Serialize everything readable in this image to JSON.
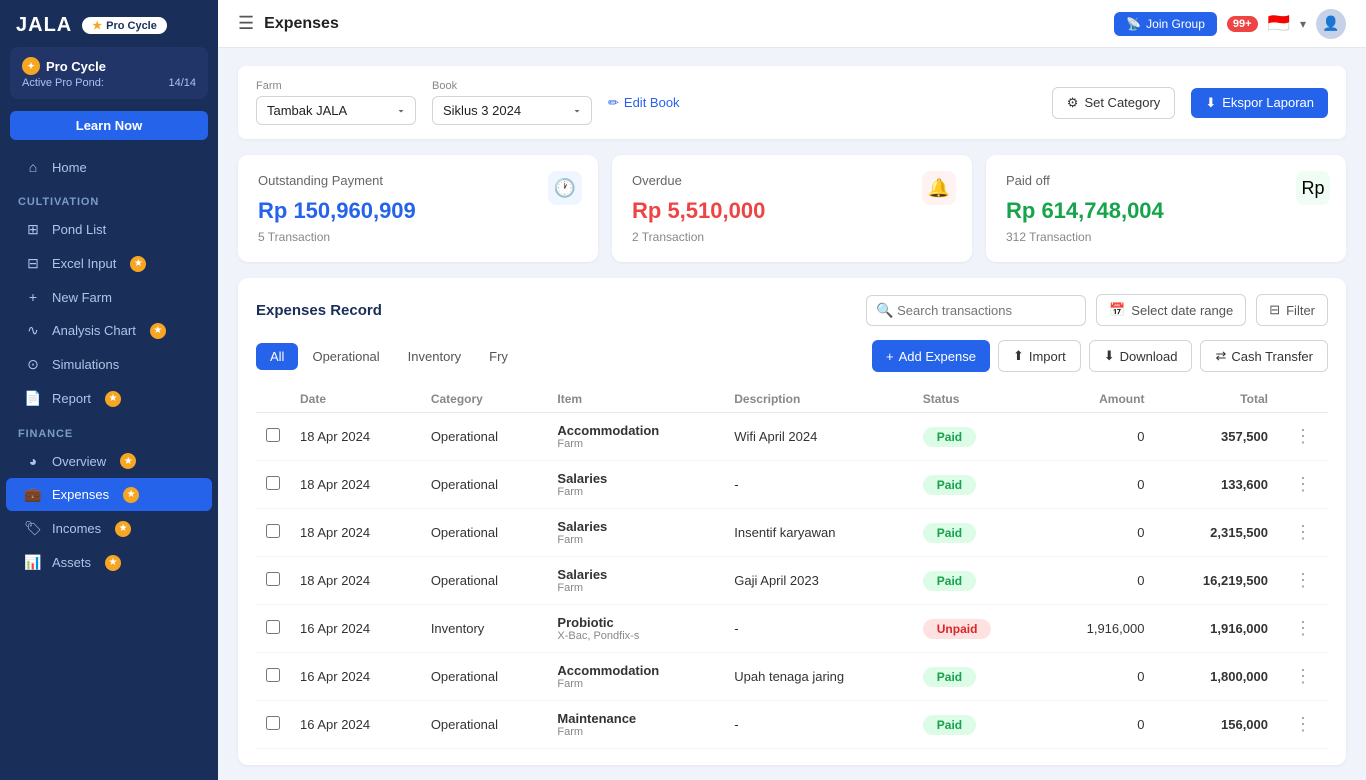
{
  "app": {
    "logo": "JALA",
    "pro_badge": "Pro Cycle",
    "title": "Expenses"
  },
  "topbar": {
    "title": "Expenses",
    "join_group_label": "Join Group",
    "notif_count": "99+",
    "menu_icon": "☰"
  },
  "sidebar": {
    "user": {
      "name": "Pro Cycle",
      "active_label": "Active Pro Pond:",
      "active_count": "14/14"
    },
    "learn_btn": "Learn Now",
    "nav_items": [
      {
        "label": "Home",
        "icon": "⌂",
        "active": false,
        "key": "home"
      },
      {
        "section": "CULTIVATION"
      },
      {
        "label": "Pond List",
        "icon": "⊞",
        "active": false,
        "key": "pond-list"
      },
      {
        "label": "Excel Input",
        "icon": "⊟",
        "badge": true,
        "active": false,
        "key": "excel-input"
      },
      {
        "label": "New Farm",
        "icon": "+",
        "active": false,
        "key": "new-farm"
      },
      {
        "label": "Analysis Chart",
        "icon": "∿",
        "badge": true,
        "active": false,
        "key": "analysis-chart"
      },
      {
        "label": "Simulations",
        "icon": "⊙",
        "active": false,
        "key": "simulations"
      },
      {
        "label": "Report",
        "icon": "📄",
        "badge": true,
        "active": false,
        "key": "report"
      },
      {
        "section": "FINANCE"
      },
      {
        "label": "Overview",
        "icon": "◕",
        "badge": true,
        "active": false,
        "key": "overview"
      },
      {
        "label": "Expenses",
        "icon": "💼",
        "badge": true,
        "active": true,
        "key": "expenses"
      },
      {
        "label": "Incomes",
        "icon": "🏷",
        "badge": true,
        "active": false,
        "key": "incomes"
      },
      {
        "label": "Assets",
        "icon": "📊",
        "badge": true,
        "active": false,
        "key": "assets"
      }
    ]
  },
  "filter_bar": {
    "farm_label": "Farm",
    "farm_value": "Tambak JALA",
    "book_label": "Book",
    "book_value": "Siklus 3 2024",
    "edit_book_label": "Edit Book",
    "set_category_label": "Set Category",
    "ekspor_label": "Ekspor Laporan"
  },
  "summary_cards": [
    {
      "title": "Outstanding Payment",
      "amount": "Rp 150,960,909",
      "amount_class": "blue",
      "sub": "5 Transaction",
      "icon": "🕐",
      "icon_class": "blue"
    },
    {
      "title": "Overdue",
      "amount": "Rp 5,510,000",
      "amount_class": "red",
      "sub": "2 Transaction",
      "icon": "🔔",
      "icon_class": "red"
    },
    {
      "title": "Paid off",
      "amount": "Rp 614,748,004",
      "amount_class": "green",
      "sub": "312 Transaction",
      "icon": "Rp",
      "icon_class": "green"
    }
  ],
  "expenses_record": {
    "title": "Expenses Record",
    "search_placeholder": "Search transactions",
    "date_range_placeholder": "Select date range",
    "filter_label": "Filter",
    "tabs": [
      {
        "label": "All",
        "active": true
      },
      {
        "label": "Operational",
        "active": false
      },
      {
        "label": "Inventory",
        "active": false
      },
      {
        "label": "Fry",
        "active": false
      }
    ],
    "add_expense_label": "Add Expense",
    "import_label": "Import",
    "download_label": "Download",
    "cash_transfer_label": "Cash Transfer",
    "rows": [
      {
        "date": "18 Apr 2024",
        "category": "Operational",
        "item_name": "Accommodation",
        "item_sub": "Farm",
        "description": "Wifi April 2024",
        "status": "Paid",
        "amount": "0",
        "total": "357,500"
      },
      {
        "date": "18 Apr 2024",
        "category": "Operational",
        "item_name": "Salaries",
        "item_sub": "Farm",
        "description": "-",
        "status": "Paid",
        "amount": "0",
        "total": "133,600"
      },
      {
        "date": "18 Apr 2024",
        "category": "Operational",
        "item_name": "Salaries",
        "item_sub": "Farm",
        "description": "Insentif karyawan",
        "status": "Paid",
        "amount": "0",
        "total": "2,315,500"
      },
      {
        "date": "18 Apr 2024",
        "category": "Operational",
        "item_name": "Salaries",
        "item_sub": "Farm",
        "description": "Gaji April 2023",
        "status": "Paid",
        "amount": "0",
        "total": "16,219,500"
      },
      {
        "date": "16 Apr 2024",
        "category": "Inventory",
        "item_name": "Probiotic",
        "item_sub": "X-Bac, Pondfix-s",
        "description": "-",
        "status": "Unpaid",
        "amount": "1,916,000",
        "total": "1,916,000"
      },
      {
        "date": "16 Apr 2024",
        "category": "Operational",
        "item_name": "Accommodation",
        "item_sub": "Farm",
        "description": "Upah tenaga jaring",
        "status": "Paid",
        "amount": "0",
        "total": "1,800,000"
      },
      {
        "date": "16 Apr 2024",
        "category": "Operational",
        "item_name": "Maintenance",
        "item_sub": "Farm",
        "description": "-",
        "status": "Paid",
        "amount": "0",
        "total": "156,000"
      }
    ]
  },
  "icons": {
    "menu": "☰",
    "home": "⌂",
    "pond_list": "⊞",
    "excel": "⊟",
    "new_farm": "+",
    "analysis": "〰",
    "simulations": "◎",
    "report": "📋",
    "overview": "●",
    "expenses": "🗂",
    "incomes": "🏷",
    "assets": "📊",
    "search": "🔍",
    "calendar": "📅",
    "filter": "⊟",
    "edit": "✏",
    "settings": "⚙",
    "download_icon": "⬇",
    "import_icon": "⬆",
    "plus": "+",
    "transfer": "⇄",
    "chevron_down": "▾",
    "more_vert": "⋮"
  }
}
